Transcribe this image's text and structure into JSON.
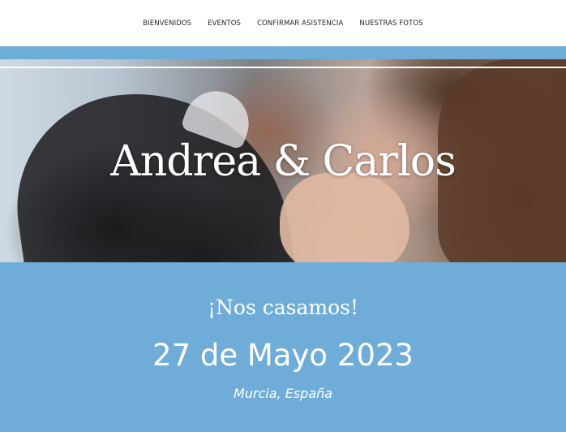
{
  "nav": {
    "items": [
      {
        "label": "BIENVENIDOS"
      },
      {
        "label": "EVENTOS"
      },
      {
        "label": "CONFIRMAR ASISTENCIA"
      },
      {
        "label": "NUESTRAS FOTOS"
      }
    ]
  },
  "hero": {
    "title": "Andrea & Carlos"
  },
  "details": {
    "announcement": "¡Nos casamos!",
    "date": "27 de Mayo 2023",
    "location": "Murcia, España"
  },
  "colors": {
    "accent_blue": "#6fadd8",
    "text_white": "#ffffff",
    "nav_text": "#1f1f1f"
  }
}
